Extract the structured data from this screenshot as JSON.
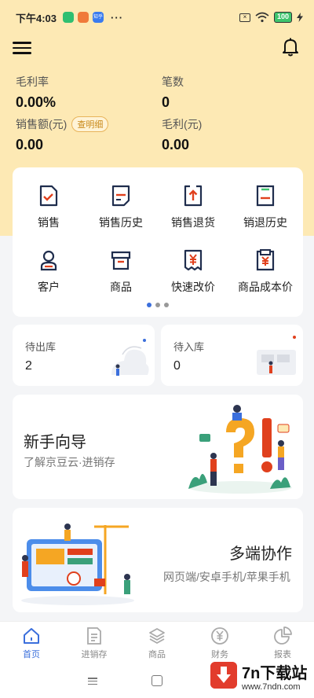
{
  "status_bar": {
    "time": "下午4:03",
    "more": "···",
    "battery": "100",
    "app_icon_colors": [
      "#2fbf71",
      "#f07a3a",
      "#3a7bef"
    ],
    "app_icon_label": "知乎"
  },
  "stats": {
    "gross_margin_rate": {
      "label": "毛利率",
      "value": "0.00%"
    },
    "count": {
      "label": "笔数",
      "value": "0"
    },
    "sales_amount": {
      "label": "销售额(元)",
      "value": "0.00",
      "tag": "查明细"
    },
    "gross_profit": {
      "label": "毛利(元)",
      "value": "0.00"
    }
  },
  "functions": [
    {
      "label": "销售",
      "icon": "sales-doc-icon"
    },
    {
      "label": "销售历史",
      "icon": "sales-history-icon"
    },
    {
      "label": "销售退货",
      "icon": "sales-return-icon"
    },
    {
      "label": "销退历史",
      "icon": "return-history-icon"
    },
    {
      "label": "客户",
      "icon": "customer-icon"
    },
    {
      "label": "商品",
      "icon": "product-box-icon"
    },
    {
      "label": "快速改价",
      "icon": "quick-price-icon"
    },
    {
      "label": "商品成本价",
      "icon": "cost-price-icon"
    }
  ],
  "pager": {
    "total": 3,
    "active_index": 0
  },
  "stock": {
    "outbound": {
      "label": "待出库",
      "value": "2"
    },
    "inbound": {
      "label": "待入库",
      "value": "0"
    }
  },
  "guide_banner": {
    "title": "新手向导",
    "subtitle": "了解京豆云·进销存"
  },
  "multi_banner": {
    "title": "多端协作",
    "subtitle": "网页端/安卓手机/苹果手机"
  },
  "tabs": [
    {
      "label": "首页",
      "icon": "home-icon",
      "active": true
    },
    {
      "label": "进销存",
      "icon": "inventory-icon",
      "active": false
    },
    {
      "label": "商品",
      "icon": "goods-layers-icon",
      "active": false
    },
    {
      "label": "财务",
      "icon": "finance-yen-icon",
      "active": false
    },
    {
      "label": "报表",
      "icon": "report-pie-icon",
      "active": false
    }
  ],
  "watermark": {
    "title": "7n下载站",
    "url": "www.7ndn.com"
  },
  "colors": {
    "accent": "#3b6fdc",
    "header_bg": "#fde9b4",
    "icon_red": "#e0401d",
    "icon_dark": "#1f2d4d"
  }
}
